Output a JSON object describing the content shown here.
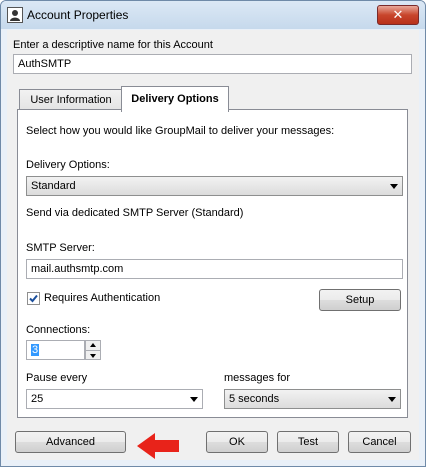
{
  "window": {
    "title": "Account Properties",
    "close_label": "✕"
  },
  "name_section": {
    "label": "Enter a descriptive name for this Account",
    "value": "AuthSMTP"
  },
  "tabs": [
    {
      "label": "User Information",
      "active": false
    },
    {
      "label": "Delivery Options",
      "active": true
    }
  ],
  "delivery": {
    "intro": "Select how you would like GroupMail to deliver your messages:",
    "options_label": "Delivery Options:",
    "options_value": "Standard",
    "description": "Send via dedicated SMTP Server (Standard)",
    "smtp_label": "SMTP Server:",
    "smtp_value": "mail.authsmtp.com",
    "requires_auth_label": "Requires Authentication",
    "requires_auth_checked": true,
    "setup_label": "Setup",
    "connections_label": "Connections:",
    "connections_value": "3",
    "pause_label": "Pause every",
    "pause_value": "25",
    "messages_for_label": "messages for",
    "messages_for_value": "5 seconds"
  },
  "footer": {
    "advanced_label": "Advanced",
    "ok_label": "OK",
    "test_label": "Test",
    "cancel_label": "Cancel"
  },
  "colors": {
    "accent_arrow": "#e8231a",
    "selection": "#3399ff"
  }
}
